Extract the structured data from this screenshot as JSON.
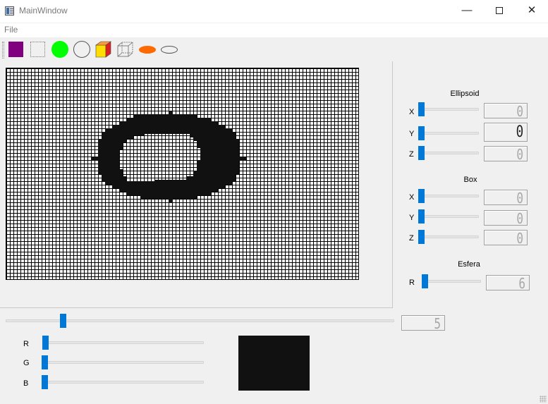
{
  "window": {
    "title": "MainWindow",
    "minimize_glyph": "—",
    "close_glyph": "✕"
  },
  "menu": {
    "items": [
      "File"
    ]
  },
  "toolbar": {
    "tools": [
      {
        "name": "square-tool",
        "icon": "filled-square-icon",
        "color": "#800080"
      },
      {
        "name": "dotted-square-tool",
        "icon": "dotted-square-icon"
      },
      {
        "name": "circle-fill-tool",
        "icon": "filled-circle-icon",
        "color": "#00ff00"
      },
      {
        "name": "circle-outline-tool",
        "icon": "circle-outline-icon"
      },
      {
        "name": "box-solid-tool",
        "icon": "solid-box-icon",
        "colors": [
          "#ffdd00",
          "#e02020"
        ]
      },
      {
        "name": "box-wire-tool",
        "icon": "wireframe-box-icon"
      },
      {
        "name": "ellipse-fill-tool",
        "icon": "filled-ellipse-icon",
        "color": "#ff6a00"
      },
      {
        "name": "ellipse-outline-tool",
        "icon": "ellipse-outline-icon"
      }
    ]
  },
  "canvas": {
    "grid_cell_color": "#000000",
    "background": "#ffffff",
    "shape_color": "#111111"
  },
  "ellipsoid": {
    "title": "Ellipsoid",
    "x": {
      "label": "X",
      "value": "0",
      "level": 0
    },
    "y": {
      "label": "Y",
      "value": "0",
      "level": 0
    },
    "z": {
      "label": "Z",
      "value": "0",
      "level": 0
    }
  },
  "box": {
    "title": "Box",
    "x": {
      "label": "X",
      "value": "0",
      "level": 0
    },
    "y": {
      "label": "Y",
      "value": "0",
      "level": 0
    },
    "z": {
      "label": "Z",
      "value": "0",
      "level": 0
    }
  },
  "esfera": {
    "title": "Esfera",
    "r": {
      "label": "R",
      "value": "6",
      "level": 0
    }
  },
  "bottom": {
    "size_slider": {
      "value": "5",
      "level": 0.15
    },
    "rgb": {
      "r": {
        "label": "R",
        "level": 0.02
      },
      "g": {
        "label": "G",
        "level": 0
      },
      "b": {
        "label": "B",
        "level": 0
      }
    },
    "preview_color": "#111111"
  }
}
